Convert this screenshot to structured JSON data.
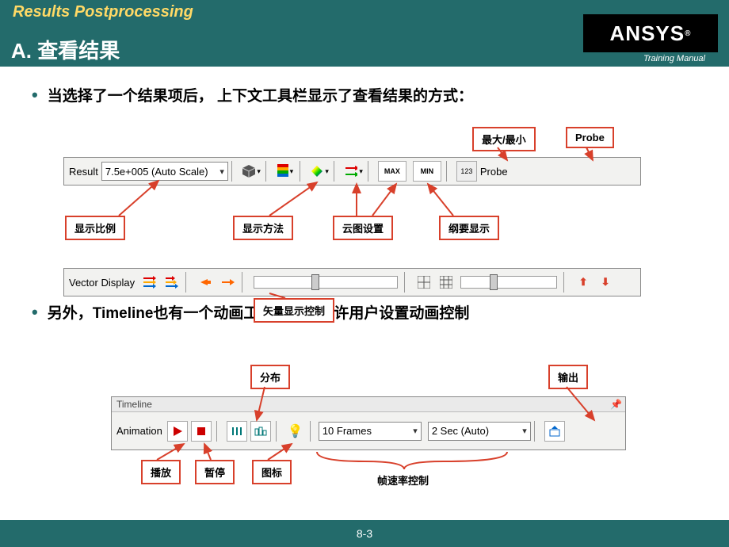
{
  "header": {
    "title": "Results Postprocessing",
    "subtitle": "A. 查看结果",
    "logo": "ANSYS",
    "training": "Training Manual"
  },
  "bullets": {
    "b1": "当选择了一个结果项后， 上下文工具栏显示了查看结果的方式：",
    "b2": "另外，Timeline也有一个动画工具栏，它允许用户设置动画控制"
  },
  "result_toolbar": {
    "label": "Result",
    "scale": "7.5e+005 (Auto Scale)",
    "max": "MAX",
    "min": "MIN",
    "probe_icon": "123",
    "probe": "Probe"
  },
  "vector_toolbar": {
    "label": "Vector Display"
  },
  "timeline": {
    "title": "Timeline",
    "anim_label": "Animation",
    "frames": "10 Frames",
    "seconds": "2 Sec (Auto)"
  },
  "callouts": {
    "maxmin": "最大/最小",
    "probe": "Probe",
    "scale": "显示比例",
    "method": "显示方法",
    "contour": "云图设置",
    "outline": "纲要显示",
    "vectorctrl": "矢量显示控制",
    "dist": "分布",
    "export": "输出",
    "play": "播放",
    "pause": "暂停",
    "icon": "图标",
    "framerate": "帧速率控制"
  },
  "footer": {
    "page": "8-3"
  }
}
